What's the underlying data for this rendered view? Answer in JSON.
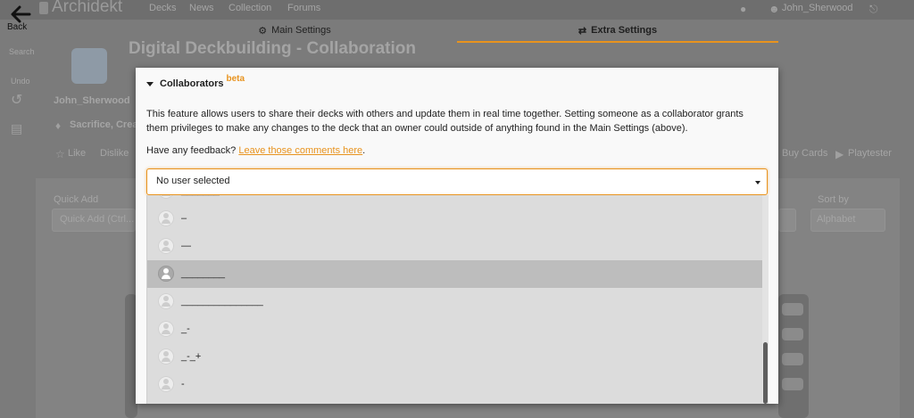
{
  "nav": {
    "brand": "Archidekt",
    "links": [
      "Decks",
      "News",
      "Collection",
      "Forums"
    ],
    "username": "John_Sherwood"
  },
  "back": {
    "label": "Back"
  },
  "left_rail": {
    "items": [
      "Search",
      "Undo"
    ]
  },
  "deck": {
    "title": "Digital Deckbuilding - Collaboration",
    "owner": "John_Sherwood",
    "tags": "Sacrifice, Crea",
    "actions_left": "Like",
    "actions_left2": "Dislike",
    "buy_cards": "Buy Cards",
    "playtester": "Playtester"
  },
  "toolbar": {
    "quick_add_label": "Quick Add",
    "quick_add_placeholder": "Quick Add (Ctrl...",
    "sort_label": "Sort by",
    "sort_value": "Alphabet"
  },
  "tabs": {
    "main": "Main Settings",
    "extra": "Extra Settings"
  },
  "collaborators": {
    "heading": "Collaborators",
    "badge": "beta",
    "description": "This feature allows users to share their decks with others and update them in real time together. Setting someone as a collaborator grants them privileges to make any changes to the deck that an owner could outside of anything found in the Main Settings (above).",
    "feedback_prefix": "Have any feedback?",
    "feedback_link": "Leave those comments here",
    "feedback_suffix": "."
  },
  "select": {
    "value": "No user selected",
    "options": [
      "_______",
      "–",
      "—",
      "________",
      "_______________",
      "_-",
      "_-_+",
      "-"
    ],
    "selected_index": 3,
    "scroll_fraction": 0.85
  },
  "colors": {
    "accent": "#e8931e",
    "modal_bg": "#f9f9f9",
    "option_selected": "#bdbdbd"
  }
}
